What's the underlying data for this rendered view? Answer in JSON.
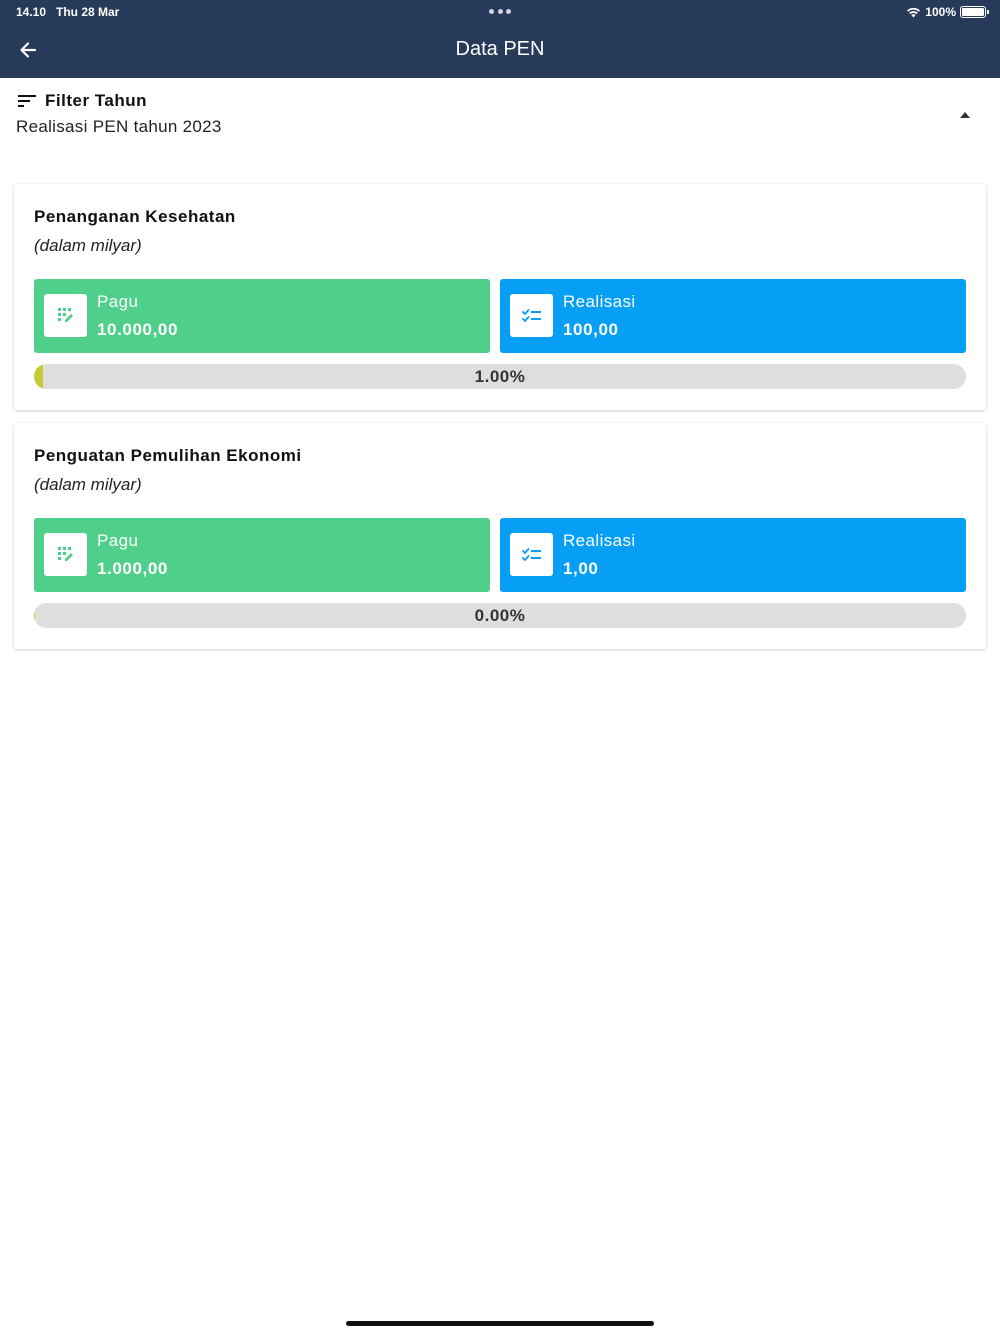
{
  "status_bar": {
    "time": "14.10",
    "date": "Thu 28 Mar",
    "battery": "100%"
  },
  "app_bar": {
    "title": "Data PEN",
    "back_icon": "arrow-left-icon"
  },
  "filter": {
    "icon": "filter-list-icon",
    "title": "Filter Tahun",
    "subtitle": "Realisasi PEN tahun 2023",
    "toggle_icon": "caret-up-icon"
  },
  "cards": [
    {
      "title": "Penanganan Kesehatan",
      "unit": "(dalam milyar)",
      "pagu": {
        "label": "Pagu",
        "value": "10.000,00",
        "icon": "grid-edit-icon"
      },
      "realisasi": {
        "label": "Realisasi",
        "value": "100,00",
        "icon": "checklist-icon"
      },
      "progress": {
        "label": "1.00%",
        "fraction": 0.01
      }
    },
    {
      "title": "Penguatan Pemulihan Ekonomi",
      "unit": "(dalam milyar)",
      "pagu": {
        "label": "Pagu",
        "value": "1.000,00",
        "icon": "grid-edit-icon"
      },
      "realisasi": {
        "label": "Realisasi",
        "value": "1,00",
        "icon": "checklist-icon"
      },
      "progress": {
        "label": "0.00%",
        "fraction": 0.001
      }
    }
  ],
  "colors": {
    "header": "#273a59",
    "pagu": "#50cf8b",
    "realisasi": "#069ff5",
    "progress_track": "#dedede",
    "progress_fill": "#c7c934"
  }
}
